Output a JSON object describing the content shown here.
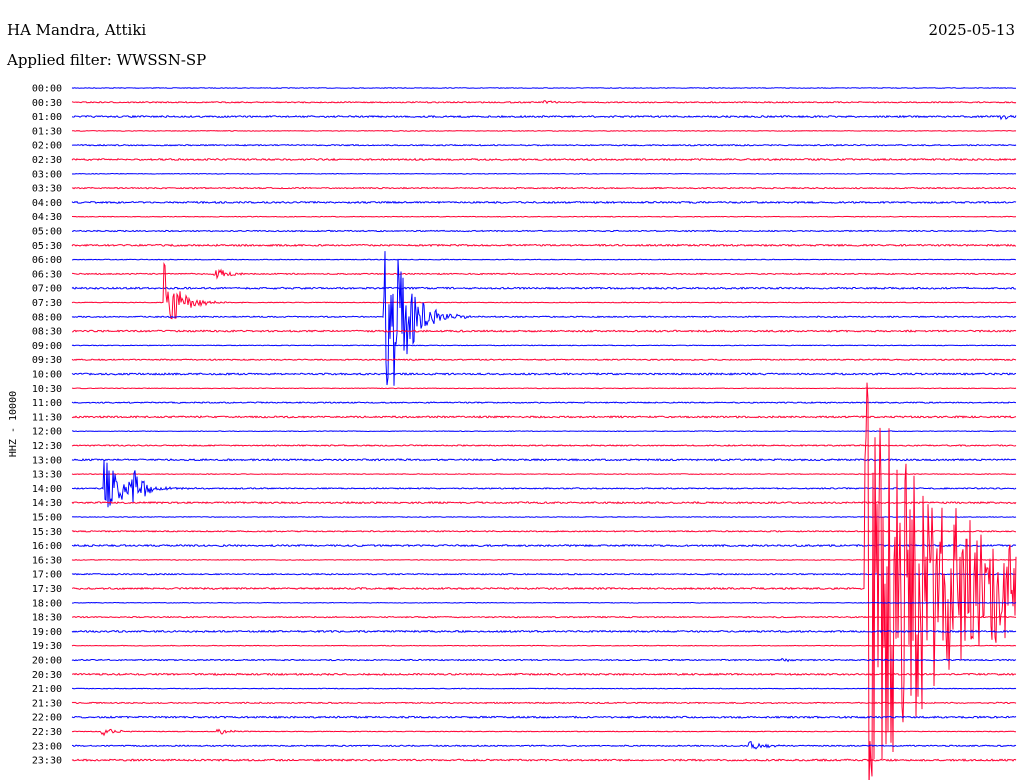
{
  "header": {
    "station": "HA Mandra, Attiki",
    "date": "2025-05-13",
    "filter": "Applied filter: WWSSN-SP"
  },
  "chart_data": {
    "type": "line",
    "title": "HA Mandra, Attiki",
    "ylabel": "HHZ - 10000",
    "row_labels": [
      "00:00",
      "00:30",
      "01:00",
      "01:30",
      "02:00",
      "02:30",
      "03:00",
      "03:30",
      "04:00",
      "04:30",
      "05:00",
      "05:30",
      "06:00",
      "06:30",
      "07:00",
      "07:30",
      "08:00",
      "08:30",
      "09:00",
      "09:30",
      "10:00",
      "10:30",
      "11:00",
      "11:30",
      "12:00",
      "12:30",
      "13:00",
      "13:30",
      "14:00",
      "14:30",
      "15:00",
      "15:30",
      "16:00",
      "16:30",
      "17:00",
      "17:30",
      "18:00",
      "18:30",
      "19:00",
      "19:30",
      "20:00",
      "20:30",
      "21:00",
      "21:30",
      "22:00",
      "22:30",
      "23:00",
      "23:30"
    ],
    "row_minutes": 30,
    "colors": {
      "even": "#0000ff",
      "odd": "#ff0033"
    },
    "events": [
      {
        "row": "00:30",
        "minute": 15.0,
        "amp_rows": 0.15,
        "dur_min": 0.6
      },
      {
        "row": "01:00",
        "minute": 29.5,
        "amp_rows": 0.25,
        "dur_min": 0.6
      },
      {
        "row": "06:30",
        "minute": 4.5,
        "amp_rows": 0.6,
        "dur_min": 0.8
      },
      {
        "row": "07:30",
        "minute": 2.9,
        "amp_rows": 3.0,
        "dur_min": 1.0
      },
      {
        "row": "08:00",
        "minute": 9.9,
        "amp_rows": 10.5,
        "dur_min": 1.2
      },
      {
        "row": "14:00",
        "minute": 1.0,
        "amp_rows": 2.2,
        "dur_min": 1.3
      },
      {
        "row": "14:00",
        "minute": 1.9,
        "amp_rows": 1.5,
        "dur_min": 0.8
      },
      {
        "row": "17:30",
        "minute": 25.2,
        "amp_rows": 16.0,
        "dur_min": 6.5
      },
      {
        "row": "20:00",
        "minute": 22.5,
        "amp_rows": 0.25,
        "dur_min": 0.5
      },
      {
        "row": "22:30",
        "minute": 0.9,
        "amp_rows": 0.4,
        "dur_min": 0.8
      },
      {
        "row": "22:30",
        "minute": 4.6,
        "amp_rows": 0.35,
        "dur_min": 0.7
      },
      {
        "row": "23:00",
        "minute": 21.5,
        "amp_rows": 0.5,
        "dur_min": 0.8
      }
    ]
  }
}
